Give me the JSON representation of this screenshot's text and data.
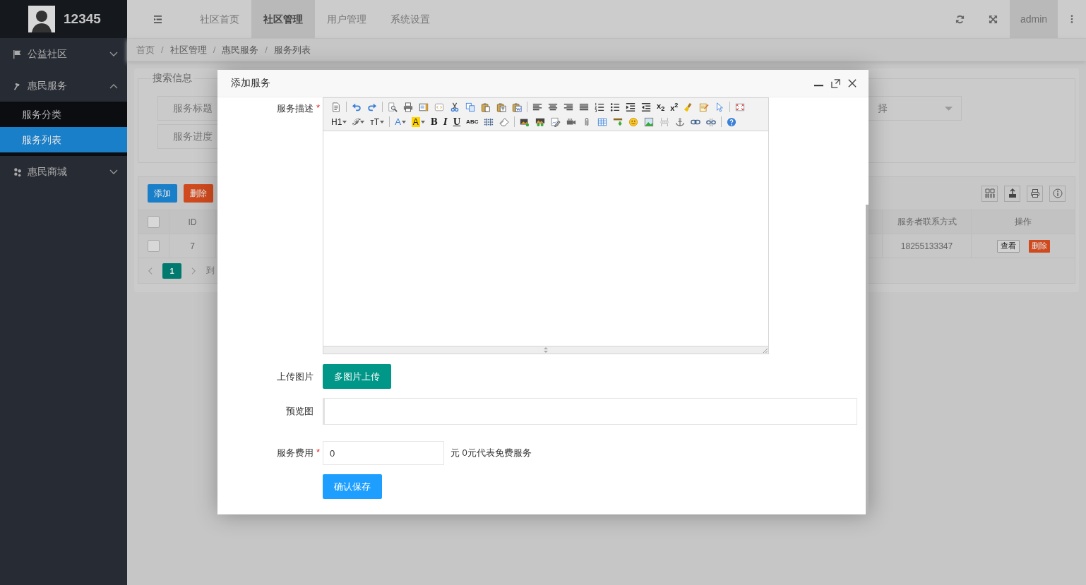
{
  "sidebar": {
    "title": "12345",
    "menu": [
      {
        "label": "公益社区",
        "expanded": false
      },
      {
        "label": "惠民服务",
        "expanded": true,
        "children": [
          {
            "label": "服务分类",
            "selected": false
          },
          {
            "label": "服务列表",
            "selected": true
          }
        ]
      },
      {
        "label": "惠民商城",
        "expanded": false
      }
    ]
  },
  "header": {
    "tabs": [
      {
        "label": "社区首页",
        "selected": false
      },
      {
        "label": "社区管理",
        "selected": true
      },
      {
        "label": "用户管理",
        "selected": false
      },
      {
        "label": "系统设置",
        "selected": false
      }
    ],
    "user": "admin"
  },
  "breadcrumb": {
    "separator": "/",
    "items": [
      "首页",
      "社区管理",
      "惠民服务",
      "服务列表"
    ]
  },
  "search": {
    "legend": "搜索信息",
    "fields": [
      "服务标题",
      "服务进度"
    ],
    "select_text": "择"
  },
  "table": {
    "buttons": [
      {
        "label": "添加",
        "kind": "primary"
      },
      {
        "label": "删除",
        "kind": "danger"
      }
    ],
    "header_checked": false,
    "columns": [
      "ID",
      "服务者联系方式",
      "操作"
    ],
    "rows": [
      {
        "selected": false,
        "id": "7",
        "contact": "18255133347",
        "actions": [
          {
            "label": "查看",
            "kind": "plain"
          },
          {
            "label": "删除",
            "kind": "danger"
          }
        ]
      }
    ],
    "pages": [
      {
        "label": "1",
        "selected": true
      }
    ],
    "goto": "到"
  },
  "dialog": {
    "title": "添加服务",
    "editor": {
      "label": "服务描述",
      "required_mark": "*",
      "toolbar": [
        [
          {
            "kind": "source"
          },
          {
            "kind": "sep"
          },
          {
            "kind": "undo"
          },
          {
            "kind": "redo"
          },
          {
            "kind": "sep"
          },
          {
            "kind": "preview"
          },
          {
            "kind": "print"
          },
          {
            "kind": "template"
          },
          {
            "kind": "code"
          },
          {
            "kind": "cut"
          },
          {
            "kind": "copy"
          },
          {
            "kind": "paste"
          },
          {
            "kind": "pastetext"
          },
          {
            "kind": "pasteword"
          },
          {
            "kind": "sep"
          },
          {
            "kind": "alignleft"
          },
          {
            "kind": "aligncenter"
          },
          {
            "kind": "alignright"
          },
          {
            "kind": "justify"
          },
          {
            "kind": "orderedlist"
          },
          {
            "kind": "bulletlist"
          },
          {
            "kind": "indent"
          },
          {
            "kind": "outdent"
          },
          {
            "kind": "sub",
            "label": "x$_{2}$"
          },
          {
            "kind": "sup",
            "label": "x$^{2}$"
          },
          {
            "kind": "brush"
          },
          {
            "kind": "autotype"
          },
          {
            "kind": "pointer"
          },
          {
            "kind": "sep"
          },
          {
            "kind": "fullscreen"
          }
        ],
        [
          {
            "kind": "heading",
            "label": "H1"
          },
          {
            "kind": "font",
            "label": "ℱ"
          },
          {
            "kind": "fontsize",
            "label": "ᴛT"
          },
          {
            "kind": "sep"
          },
          {
            "kind": "fontcolor",
            "label": "A"
          },
          {
            "kind": "highlight",
            "label": "A"
          },
          {
            "kind": "bold",
            "label": "B"
          },
          {
            "kind": "italic",
            "label": "I"
          },
          {
            "kind": "underline",
            "label": "U"
          },
          {
            "kind": "strike",
            "label": "ABC"
          },
          {
            "kind": "lineheight"
          },
          {
            "kind": "eraser"
          },
          {
            "kind": "sep"
          },
          {
            "kind": "image"
          },
          {
            "kind": "multiimage"
          },
          {
            "kind": "scrawl"
          },
          {
            "kind": "video"
          },
          {
            "kind": "attachment"
          },
          {
            "kind": "table"
          },
          {
            "kind": "insertrow"
          },
          {
            "kind": "emotion"
          },
          {
            "kind": "picture"
          },
          {
            "kind": "pagebreak"
          },
          {
            "kind": "anchor"
          },
          {
            "kind": "link"
          },
          {
            "kind": "unlink"
          },
          {
            "kind": "sep"
          },
          {
            "kind": "help"
          }
        ]
      ]
    },
    "upload": {
      "label": "上传图片",
      "button": "多图片上传"
    },
    "preview": {
      "label": "预览图"
    },
    "fee": {
      "label": "服务费用",
      "required_mark": "*",
      "value": "0",
      "hint": "元 0元代表免费服务"
    },
    "submit": "确认保存"
  }
}
